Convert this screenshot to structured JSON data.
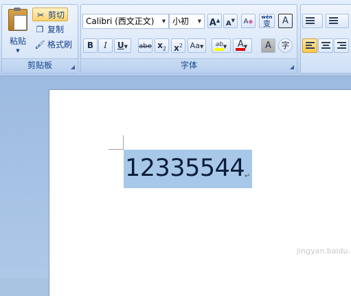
{
  "clipboard": {
    "paste_label": "粘贴",
    "cut_label": "剪切",
    "copy_label": "复制",
    "format_painter_label": "格式刷",
    "group_label": "剪贴板"
  },
  "font": {
    "font_name": "Calibri (西文正文)",
    "font_size": "小初",
    "group_label": "字体",
    "grow_font": "A",
    "shrink_font": "A",
    "clear_format": "A",
    "phonetic_guide": "wén",
    "phonetic_char": "变",
    "char_border": "A",
    "bold": "B",
    "italic": "I",
    "underline": "U",
    "strikethrough": "abe",
    "subscript_base": "x",
    "subscript_mark": "2",
    "superscript_base": "x",
    "superscript_mark": "2",
    "change_case": "Aa",
    "highlight": "ab",
    "font_color": "A",
    "char_shading": "A",
    "enclose_char": "字",
    "highlight_color": "#ffff00",
    "font_color_value": "#e00000"
  },
  "document": {
    "text": "12335544",
    "paragraph_mark": "↵",
    "watermark": "jingyan.baidu.com"
  }
}
